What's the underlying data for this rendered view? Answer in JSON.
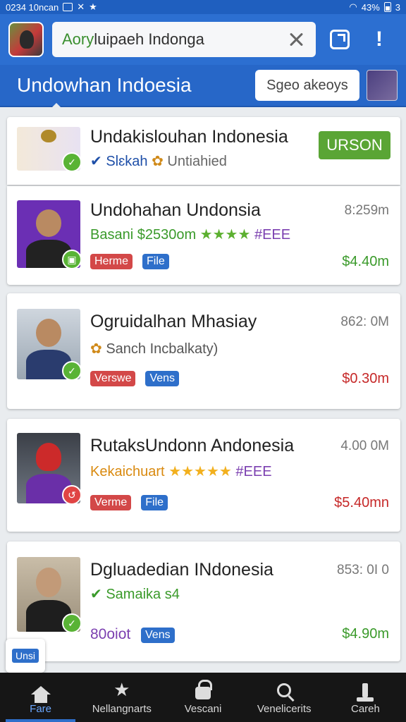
{
  "status_bar": {
    "time_text": "0234 10ncan",
    "battery": "43%",
    "signal_text": "3"
  },
  "search": {
    "prefix": "Aory",
    "rest": "luipaeh Indonga"
  },
  "title_bar": {
    "title": "Undowhan Indoesia",
    "button_label": "Sgeo akeoys"
  },
  "items": [
    {
      "name": "Undakislouhan Indonesia",
      "sub1": "Slɛkah",
      "sub2": "Untiahied",
      "action": "URSON"
    },
    {
      "name": "Undohahan Undonsia",
      "meta": "Basani $2530om",
      "stars": "★★★★",
      "code": "#EEE",
      "time": "8:259m",
      "price": "$4.40m",
      "tag1": "Herme",
      "tag2": "File"
    },
    {
      "name": "Ogruidalhan Mhasiay",
      "meta": "Sanch Incbalkaty)",
      "time": "862: 0M",
      "price": "$0.30m",
      "tag1": "Verswe",
      "tag2": "Vens"
    },
    {
      "name": "RutaksUndonn Andonesia",
      "meta": "Kekaichuart",
      "stars": "★★★★★",
      "code": "#EEE",
      "time": "4.00 0M",
      "price": "$5.40mn",
      "tag1": "Verme",
      "tag2": "File"
    },
    {
      "name": "Dgluadedian INdonesia",
      "meta": "Samaika s4",
      "time": "853: 0I 0",
      "price": "$4.90m",
      "extra": "80oiot",
      "tag2": "Vens"
    }
  ],
  "float_button": "Unsi",
  "bottom_nav": [
    {
      "label": "Fare",
      "icon": "home-icon"
    },
    {
      "label": "Nellangnarts",
      "icon": "star-icon"
    },
    {
      "label": "Vescani",
      "icon": "lock-icon"
    },
    {
      "label": "Venelicerits",
      "icon": "search-icon"
    },
    {
      "label": "Careh",
      "icon": "download-icon"
    }
  ],
  "colors": {
    "primary": "#2767c8",
    "green": "#5aa535",
    "red": "#d34848",
    "purple": "#7b3fb0"
  }
}
